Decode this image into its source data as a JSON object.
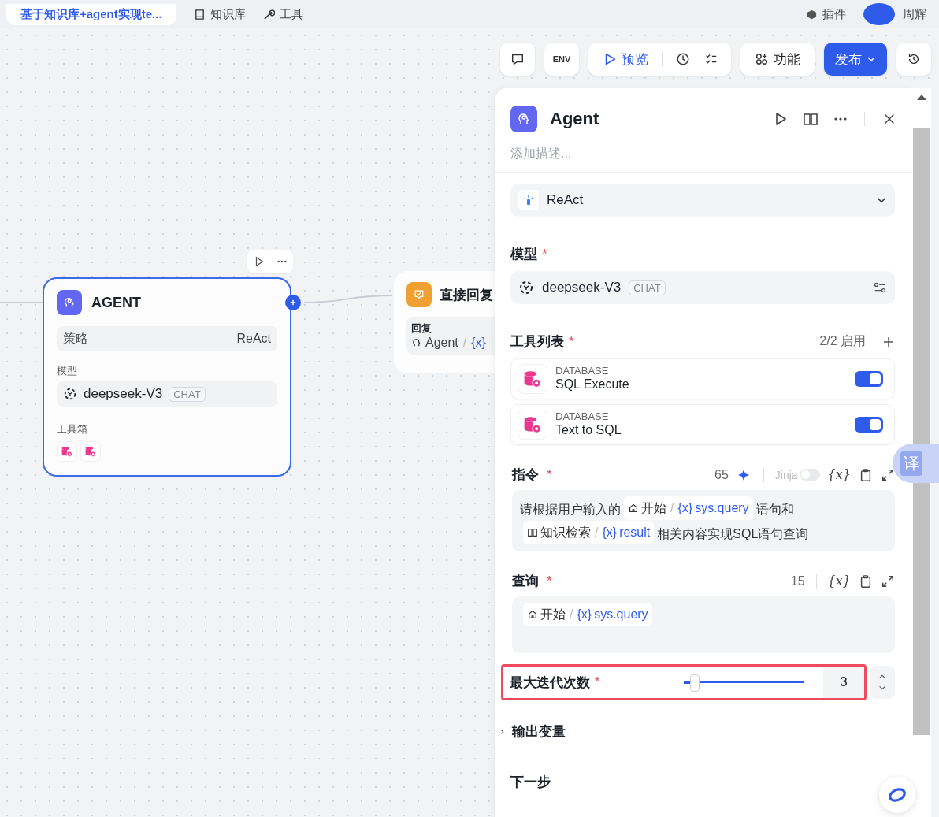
{
  "topbar": {
    "workflow_title": "基于知识库+agent实现te...",
    "nav": [
      {
        "label": "知识库"
      },
      {
        "label": "工具"
      }
    ],
    "plugins": "插件",
    "user": "周辉"
  },
  "toolbar": {
    "env": "ENV",
    "preview": "预览",
    "features": "功能",
    "publish": "发布"
  },
  "canvas": {
    "agent_node": {
      "title": "AGENT",
      "strategy_label": "策略",
      "strategy": "ReAct",
      "model_label": "模型",
      "model": "deepseek-V3",
      "model_tag": "CHAT",
      "toolbox_label": "工具箱",
      "selected": true
    },
    "reply_node": {
      "title": "直接回复",
      "field_label": "回复",
      "source": "Agent",
      "separator": "/",
      "var": "{x}"
    }
  },
  "panel": {
    "title": "Agent",
    "description_placeholder": "添加描述...",
    "strategy": "ReAct",
    "model": {
      "label": "模型",
      "required_mark": "*",
      "name": "deepseek-V3",
      "tag": "CHAT"
    },
    "tools": {
      "label": "工具列表",
      "required_mark": "*",
      "count": "2/2 启用",
      "items": [
        {
          "category": "DATABASE",
          "name": "SQL Execute",
          "on": true
        },
        {
          "category": "DATABASE",
          "name": "Text to SQL",
          "on": true
        }
      ]
    },
    "instruction": {
      "label": "指令",
      "required_mark": "*",
      "count": "65",
      "jinja_label": "Jinja",
      "jinja_on": false,
      "var_button": "{x}",
      "segments": [
        {
          "kind": "text",
          "text": "请根据用户输入的"
        },
        {
          "kind": "start_ref",
          "node": "开始",
          "separator": "/",
          "prefix": "{x}",
          "var": "sys.query"
        },
        {
          "kind": "text",
          "text": "语句和"
        },
        {
          "kind": "knowledge_ref",
          "node": "知识检索",
          "separator": "/",
          "prefix": "{x}",
          "var": "result"
        },
        {
          "kind": "text",
          "text": "相关内容实现SQL语句查询"
        }
      ]
    },
    "query": {
      "label": "查询",
      "required_mark": "*",
      "count": "15",
      "var_button": "{x}",
      "segments": [
        {
          "kind": "start_ref",
          "node": "开始",
          "separator": "/",
          "prefix": "{x}",
          "var": "sys.query"
        }
      ]
    },
    "max_iterations": {
      "label": "最大迭代次数",
      "required_mark": "*",
      "level": 0.05,
      "value": "3",
      "highlighted": true
    },
    "output": {
      "label": "输出变量",
      "expanded": false
    },
    "next": "下一步"
  },
  "translate_button": "译"
}
